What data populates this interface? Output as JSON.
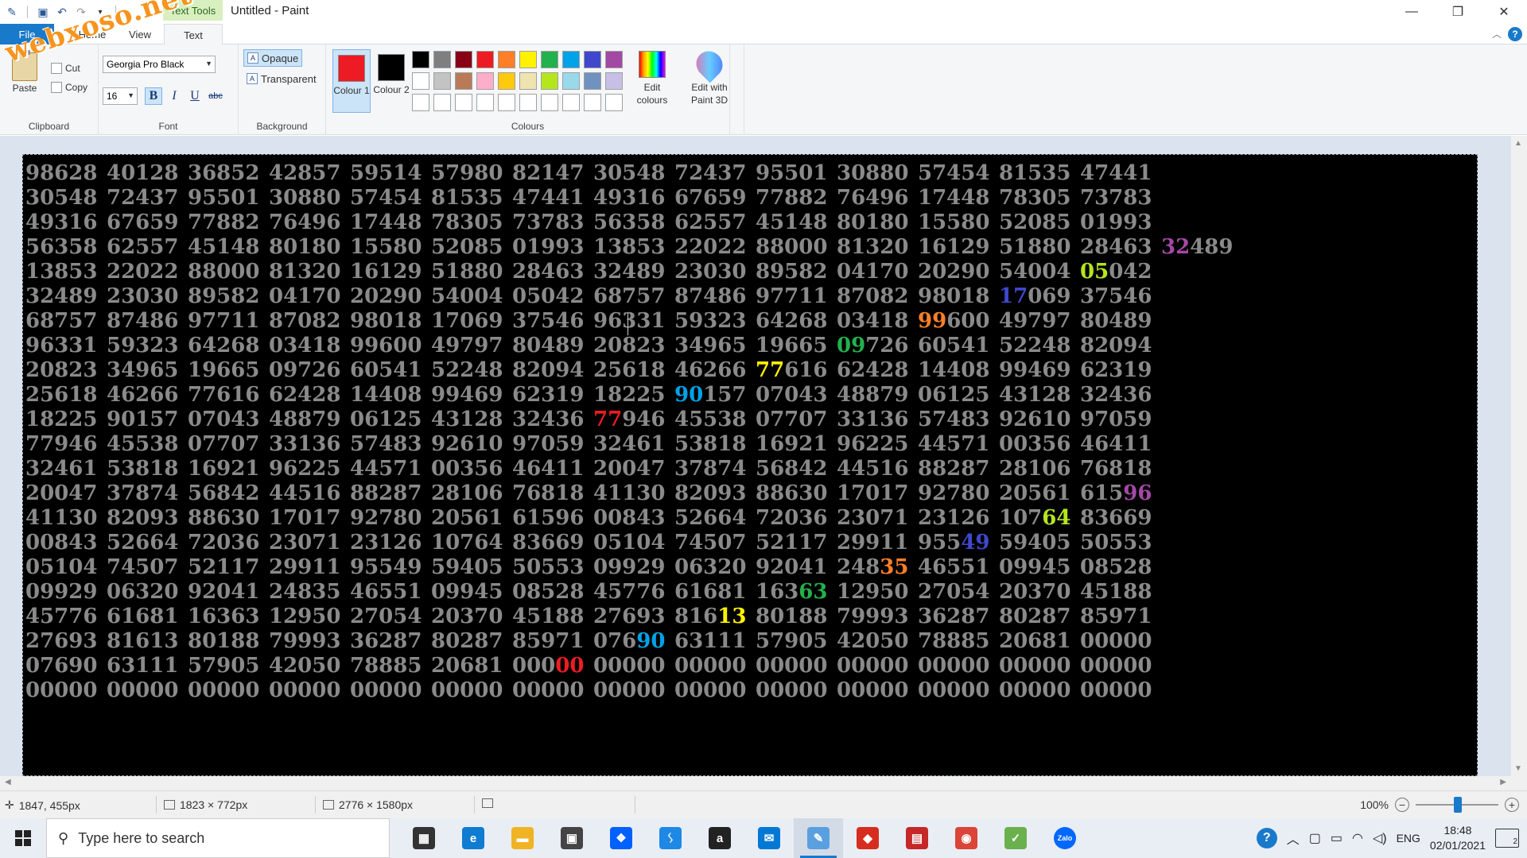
{
  "window": {
    "title": "Untitled - Paint",
    "context_tab_group": "Text Tools"
  },
  "tabs": [
    {
      "label": "File"
    },
    {
      "label": "Home"
    },
    {
      "label": "View"
    },
    {
      "label": "Text"
    }
  ],
  "ribbon": {
    "clipboard": {
      "label": "Clipboard",
      "paste": "Paste",
      "cut": "Cut",
      "copy": "Copy"
    },
    "font": {
      "label": "Font",
      "family": "Georgia Pro Black",
      "size": "16",
      "bold": "B",
      "italic": "I",
      "underline": "U",
      "strike": "abc"
    },
    "background": {
      "label": "Background",
      "opaque": "Opaque",
      "transparent": "Transparent"
    },
    "colours": {
      "label": "Colours",
      "colour1": "Colour 1",
      "colour2": "Colour 2",
      "colour1_value": "#ed1c24",
      "colour2_value": "#000000",
      "edit_colours": "Edit colours",
      "edit_paint3d": "Edit with Paint 3D",
      "palette_row1": [
        "#000000",
        "#7f7f7f",
        "#880015",
        "#ed1c24",
        "#ff7f27",
        "#fff200",
        "#22b14c",
        "#00a2e8",
        "#3f48cc",
        "#a349a4"
      ],
      "palette_row2": [
        "#ffffff",
        "#c3c3c3",
        "#b97a57",
        "#ffaec9",
        "#ffc90e",
        "#efe4b0",
        "#b5e61d",
        "#99d9ea",
        "#7092be",
        "#c8bfe7"
      ],
      "palette_row3": [
        "#ffffff",
        "#ffffff",
        "#ffffff",
        "#ffffff",
        "#ffffff",
        "#ffffff",
        "#ffffff",
        "#ffffff",
        "#ffffff",
        "#ffffff"
      ]
    }
  },
  "canvas": {
    "base_colour": "#8a8a8a",
    "background": "#000000",
    "rows": [
      [
        "98628",
        "40128",
        "36852",
        "42857",
        "59514",
        "57980",
        "82147",
        "30548",
        "72437",
        "95501",
        "30880",
        "57454",
        "81535",
        "47441"
      ],
      [
        "30548",
        "72437",
        "95501",
        "30880",
        "57454",
        "81535",
        "47441",
        "49316",
        "67659",
        "77882",
        "76496",
        "17448",
        "78305",
        "73783"
      ],
      [
        "49316",
        "67659",
        "77882",
        "76496",
        "17448",
        "78305",
        "73783",
        "56358",
        "62557",
        "45148",
        "80180",
        "15580",
        "52085",
        "01993"
      ],
      [
        "56358",
        "62557",
        "45148",
        "80180",
        "15580",
        "52085",
        "01993",
        "13853",
        "22022",
        "88000",
        "81320",
        "16129",
        "51880",
        "28463",
        "32489"
      ],
      [
        "13853",
        "22022",
        "88000",
        "81320",
        "16129",
        "51880",
        "28463",
        "32489",
        "23030",
        "89582",
        "04170",
        "20290",
        "54004",
        "05042"
      ],
      [
        "32489",
        "23030",
        "89582",
        "04170",
        "20290",
        "54004",
        "05042",
        "68757",
        "87486",
        "97711",
        "87082",
        "98018",
        "17069",
        "37546"
      ],
      [
        "68757",
        "87486",
        "97711",
        "87082",
        "98018",
        "17069",
        "37546",
        "96331",
        "59323",
        "64268",
        "03418",
        "99600",
        "49797",
        "80489"
      ],
      [
        "96331",
        "59323",
        "64268",
        "03418",
        "99600",
        "49797",
        "80489",
        "20823",
        "34965",
        "19665",
        "09726",
        "60541",
        "52248",
        "82094"
      ],
      [
        "20823",
        "34965",
        "19665",
        "09726",
        "60541",
        "52248",
        "82094",
        "25618",
        "46266",
        "77616",
        "62428",
        "14408",
        "99469",
        "62319"
      ],
      [
        "25618",
        "46266",
        "77616",
        "62428",
        "14408",
        "99469",
        "62319",
        "18225",
        "90157",
        "07043",
        "48879",
        "06125",
        "43128",
        "32436"
      ],
      [
        "18225",
        "90157",
        "07043",
        "48879",
        "06125",
        "43128",
        "32436",
        "77946",
        "45538",
        "07707",
        "33136",
        "57483",
        "92610",
        "97059"
      ],
      [
        "77946",
        "45538",
        "07707",
        "33136",
        "57483",
        "92610",
        "97059",
        "32461",
        "53818",
        "16921",
        "96225",
        "44571",
        "00356",
        "46411"
      ],
      [
        "32461",
        "53818",
        "16921",
        "96225",
        "44571",
        "00356",
        "46411",
        "20047",
        "37874",
        "56842",
        "44516",
        "88287",
        "28106",
        "76818"
      ],
      [
        "20047",
        "37874",
        "56842",
        "44516",
        "88287",
        "28106",
        "76818",
        "41130",
        "82093",
        "88630",
        "17017",
        "92780",
        "20561",
        "61596"
      ],
      [
        "41130",
        "82093",
        "88630",
        "17017",
        "92780",
        "20561",
        "61596",
        "00843",
        "52664",
        "72036",
        "23071",
        "23126",
        "10764",
        "83669"
      ],
      [
        "00843",
        "52664",
        "72036",
        "23071",
        "23126",
        "10764",
        "83669",
        "05104",
        "74507",
        "52117",
        "29911",
        "95549",
        "59405",
        "50553"
      ],
      [
        "05104",
        "74507",
        "52117",
        "29911",
        "95549",
        "59405",
        "50553",
        "09929",
        "06320",
        "92041",
        "24835",
        "46551",
        "09945",
        "08528"
      ],
      [
        "09929",
        "06320",
        "92041",
        "24835",
        "46551",
        "09945",
        "08528",
        "45776",
        "61681",
        "16363",
        "12950",
        "27054",
        "20370",
        "45188"
      ],
      [
        "45776",
        "61681",
        "16363",
        "12950",
        "27054",
        "20370",
        "45188",
        "27693",
        "81613",
        "80188",
        "79993",
        "36287",
        "80287",
        "85971"
      ],
      [
        "27693",
        "81613",
        "80188",
        "79993",
        "36287",
        "80287",
        "85971",
        "07690",
        "63111",
        "57905",
        "42050",
        "78885",
        "20681",
        "00000"
      ],
      [
        "07690",
        "63111",
        "57905",
        "42050",
        "78885",
        "20681",
        "00000",
        "00000",
        "00000",
        "00000",
        "00000",
        "00000",
        "00000",
        "00000"
      ],
      [
        "00000",
        "00000",
        "00000",
        "00000",
        "00000",
        "00000",
        "00000",
        "00000",
        "00000",
        "00000",
        "00000",
        "00000",
        "00000",
        "00000"
      ]
    ],
    "highlights": [
      {
        "row": 3,
        "col": 14,
        "digits": "32",
        "pos": "start",
        "colour": "#a349a4"
      },
      {
        "row": 4,
        "col": 13,
        "digits": "05",
        "pos": "start",
        "colour": "#b5e61d"
      },
      {
        "row": 5,
        "col": 12,
        "digits": "17",
        "pos": "start",
        "colour": "#3f48cc"
      },
      {
        "row": 6,
        "col": 11,
        "digits": "99",
        "pos": "start",
        "colour": "#ff7f27"
      },
      {
        "row": 7,
        "col": 10,
        "digits": "09",
        "pos": "start",
        "colour": "#22b14c"
      },
      {
        "row": 8,
        "col": 9,
        "digits": "77",
        "pos": "start",
        "colour": "#fff200"
      },
      {
        "row": 9,
        "col": 8,
        "digits": "90",
        "pos": "start",
        "colour": "#00a2e8"
      },
      {
        "row": 10,
        "col": 7,
        "digits": "77",
        "pos": "start",
        "colour": "#ed1c24"
      },
      {
        "row": 13,
        "col": 13,
        "digits": "96",
        "pos": "end",
        "colour": "#a349a4"
      },
      {
        "row": 14,
        "col": 12,
        "digits": "64",
        "pos": "end",
        "colour": "#b5e61d"
      },
      {
        "row": 15,
        "col": 11,
        "digits": "49",
        "pos": "end",
        "colour": "#3f48cc"
      },
      {
        "row": 16,
        "col": 10,
        "digits": "35",
        "pos": "end",
        "colour": "#ff7f27"
      },
      {
        "row": 17,
        "col": 9,
        "digits": "63",
        "pos": "end",
        "colour": "#22b14c"
      },
      {
        "row": 18,
        "col": 8,
        "digits": "13",
        "pos": "end",
        "colour": "#fff200"
      },
      {
        "row": 19,
        "col": 7,
        "digits": "90",
        "pos": "end",
        "colour": "#00a2e8"
      },
      {
        "row": 20,
        "col": 6,
        "digits": "00",
        "pos": "end",
        "colour": "#ed1c24"
      }
    ]
  },
  "statusbar": {
    "cursor_pos": "1847, 455px",
    "selection_size": "1823 × 772px",
    "image_size": "2776 × 1580px",
    "zoom": "100%"
  },
  "taskbar": {
    "search_placeholder": "Type here to search",
    "language": "ENG",
    "time": "18:48",
    "date": "02/01/2021",
    "notification_count": "2",
    "apps": [
      {
        "name": "task-view",
        "glyph": "▦",
        "color": "#333333"
      },
      {
        "name": "edge",
        "glyph": "e",
        "color": "#0f7bd1"
      },
      {
        "name": "file-explorer",
        "glyph": "▬",
        "color": "#f0b323"
      },
      {
        "name": "store",
        "glyph": "▣",
        "color": "#444444"
      },
      {
        "name": "dropbox",
        "glyph": "❖",
        "color": "#0061ff"
      },
      {
        "name": "visual-studio-code",
        "glyph": "ᛊ",
        "color": "#1e88e5"
      },
      {
        "name": "amazon",
        "glyph": "a",
        "color": "#222222"
      },
      {
        "name": "mail",
        "glyph": "✉",
        "color": "#0078d4"
      },
      {
        "name": "paint",
        "glyph": "✎",
        "color": "#5aa0e0"
      },
      {
        "name": "app-red-green",
        "glyph": "◆",
        "color": "#d62d20"
      },
      {
        "name": "app-red-grid",
        "glyph": "▤",
        "color": "#c62828"
      },
      {
        "name": "chrome",
        "glyph": "◉",
        "color": "#db4437"
      },
      {
        "name": "app-green-check",
        "glyph": "✓",
        "color": "#6ab04c"
      },
      {
        "name": "zalo",
        "glyph": "Zalo",
        "color": "#0068ff"
      }
    ]
  },
  "watermark": "webxoso.net"
}
